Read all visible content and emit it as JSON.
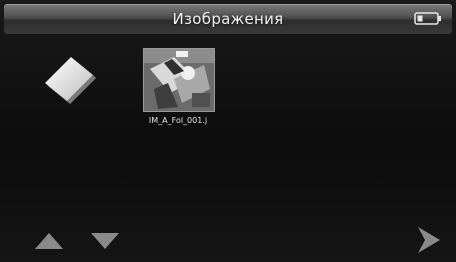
{
  "header": {
    "title": "Изображения"
  },
  "icons": {
    "battery": "battery-icon",
    "folder_up": "folder-up-icon",
    "scroll_up": "arrow-up-icon",
    "scroll_down": "arrow-down-icon",
    "next": "arrow-right-icon"
  },
  "files": [
    {
      "name": "IM_A_Fol_001.j"
    }
  ],
  "colors": {
    "background": "#0f0f0f",
    "titlebar": "#4e4e4e",
    "text": "#f2f2f2",
    "nav_arrow": "#8a8a8a"
  }
}
